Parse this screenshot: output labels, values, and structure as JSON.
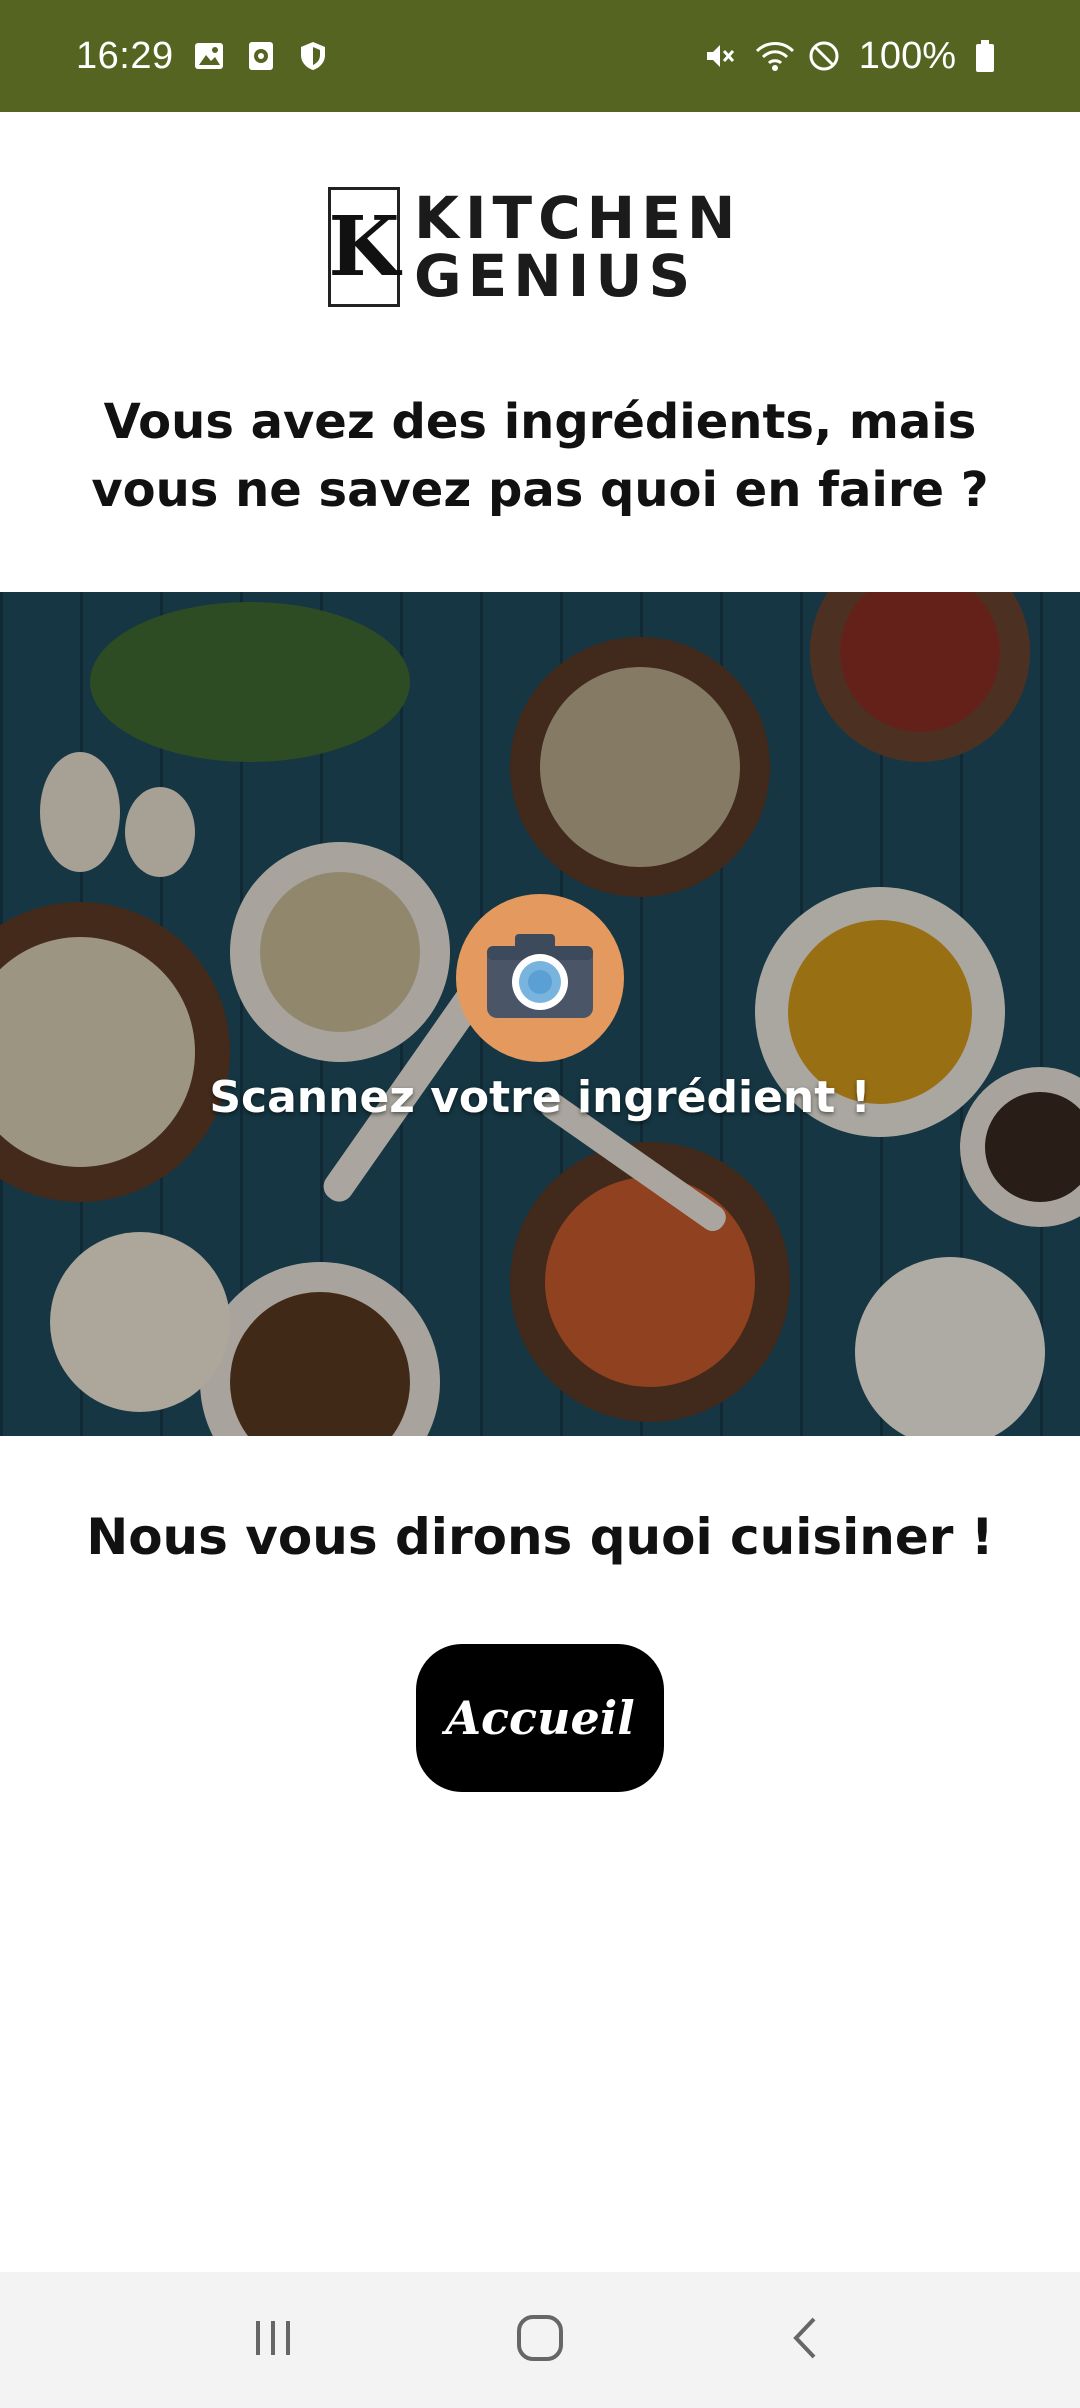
{
  "status_bar": {
    "time": "16:29",
    "battery": "100%",
    "left_icons": [
      "image-icon",
      "camera-app-icon",
      "shield-icon"
    ],
    "right_icons": [
      "mute-icon",
      "wifi-icon",
      "dnd-icon",
      "battery-icon"
    ],
    "background": "#566421"
  },
  "logo": {
    "letter": "K",
    "line1": "KITCHEN",
    "line2": "GENIUS"
  },
  "headline": "Vous avez des ingrédients, mais vous ne savez pas quoi en faire ?",
  "hero": {
    "scan_label": "Scannez votre ingrédient !",
    "camera_icon": "camera-icon",
    "accent": "#e49a5e"
  },
  "subheadline": "Nous vous dirons quoi cuisiner !",
  "home_button": {
    "label": "Accueil"
  },
  "nav_bar": {
    "items": [
      "recent-apps-icon",
      "home-icon",
      "back-icon"
    ]
  }
}
